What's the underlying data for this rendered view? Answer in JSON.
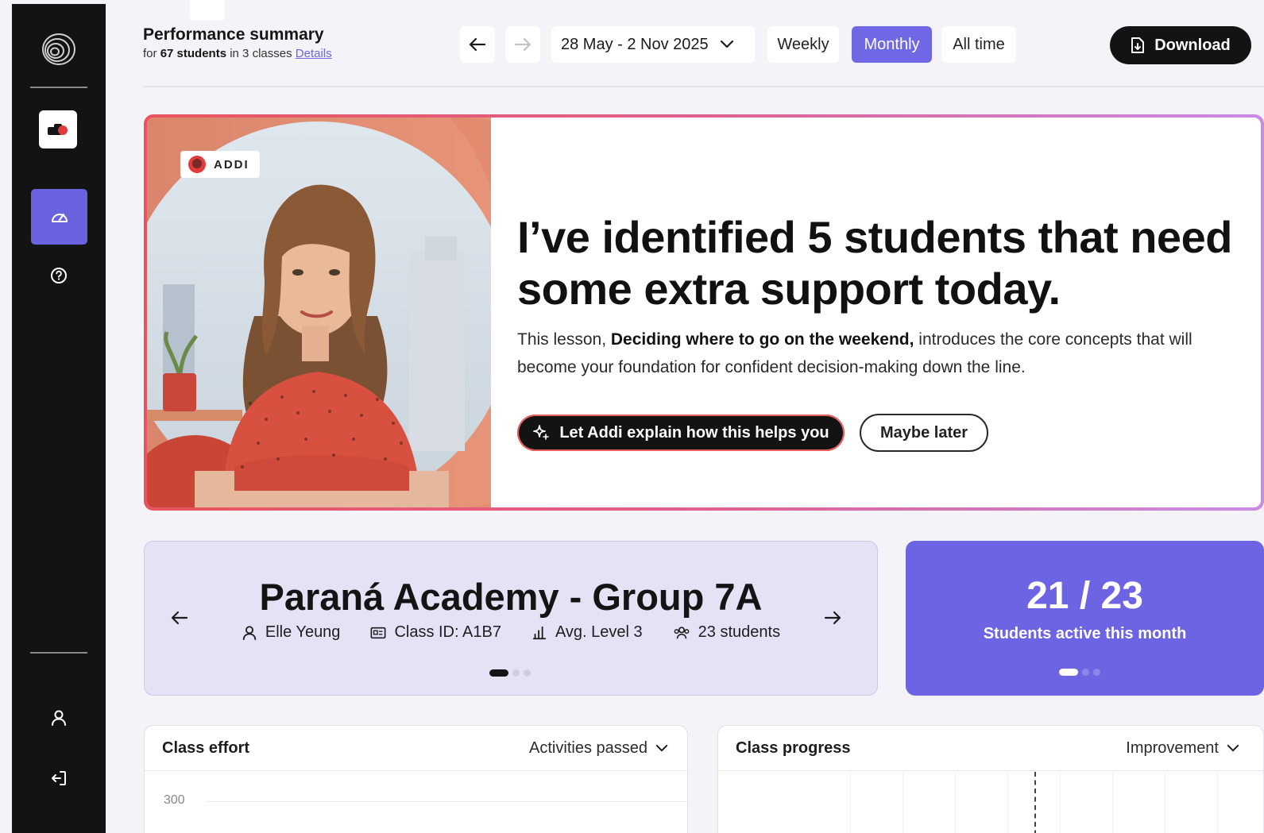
{
  "header": {
    "title": "Performance summary",
    "sub_prefix": "for",
    "students_count": "67 students",
    "sub_middle": "in 3 classes",
    "details_link": "Details",
    "date_range": "28 May - 2 Nov 2025",
    "period_tabs": [
      "Weekly",
      "Monthly",
      "All time"
    ],
    "active_period": "Monthly",
    "download_label": "Download"
  },
  "hero": {
    "badge": "ADDI",
    "headline": "I’ve identified 5 students that need some extra support today.",
    "body_prefix": "This lesson,",
    "lesson_name": "Deciding where to go on the weekend,",
    "body_suffix": "introduces the core concepts that will become your foundation for confident decision-making down the line.",
    "cta_label": "Let Addi explain how this helps you",
    "later_label": "Maybe later"
  },
  "class_card": {
    "title": "Paraná Academy - Group 7A",
    "teacher": "Elle Yeung",
    "class_id": "Class ID: A1B7",
    "avg_level": "Avg. Level 3",
    "students": "23 students"
  },
  "active_card": {
    "value": "21 / 23",
    "label": "Students active this month"
  },
  "panels": {
    "effort": {
      "title": "Class effort",
      "dropdown": "Activities passed",
      "tick": "300"
    },
    "progress": {
      "title": "Class progress",
      "dropdown": "Improvement"
    }
  },
  "colors": {
    "accent": "#6c64e3",
    "sidebar": "#131313",
    "hero_border_start": "#e9555f",
    "hero_border_end": "#c98be6"
  }
}
